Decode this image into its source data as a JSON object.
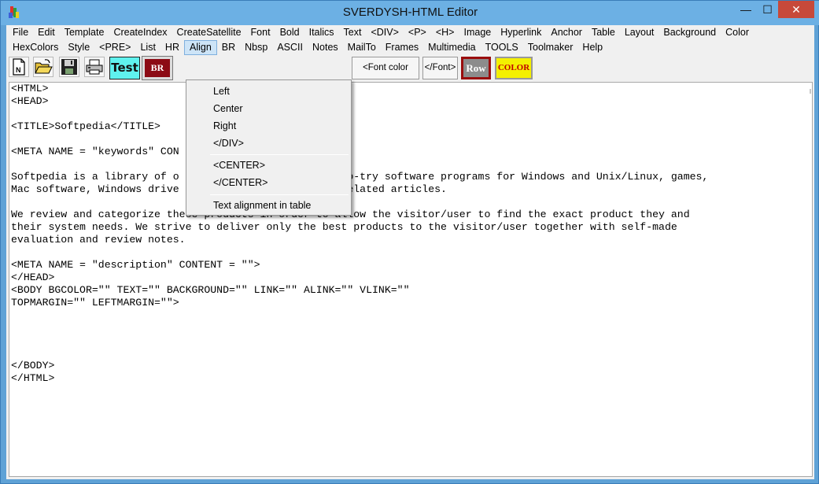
{
  "window": {
    "title": "SVERDYSH-HTML Editor",
    "min": "—",
    "max": "☐",
    "close": "✕"
  },
  "menu1": [
    "File",
    "Edit",
    "Template",
    "CreateIndex",
    "CreateSatellite",
    "Font",
    "Bold",
    "Italics",
    "Text",
    "<DIV>",
    "<P>",
    "<H>",
    "Image",
    "Hyperlink",
    "Anchor",
    "Table",
    "Layout",
    "Background",
    "Color"
  ],
  "menu2": [
    "HexColors",
    "Style",
    "<PRE>",
    "List",
    "HR",
    "Align",
    "BR",
    "Nbsp",
    "ASCII",
    "Notes",
    "MailTo",
    "Frames",
    "Multimedia",
    "TOOLS",
    "Toolmaker",
    "Help"
  ],
  "toolbar": {
    "new_icon": "new-document-icon",
    "open_icon": "open-folder-icon",
    "save_icon": "floppy-disk-icon",
    "print_icon": "printer-icon",
    "test": "Test",
    "br": "BR",
    "font_color_size": "<Font color size>",
    "font_close": "</Font>",
    "row": "Row",
    "color": "COLOR"
  },
  "align_menu": {
    "items": [
      "Left",
      "Center",
      "Right",
      "</DIV>"
    ],
    "items2": [
      "<CENTER>",
      "</CENTER>"
    ],
    "items3": [
      "Text alignment in table"
    ]
  },
  "editor_lines": [
    "<HTML>",
    "<HEAD>",
    "",
    "<TITLE>Softpedia</TITLE>",
    "",
    "<META NAME = \"keywords\" CON",
    "",
    "Softpedia is a library of o                          to-try software programs for Windows and Unix/Linux, games,",
    "Mac software, Windows drive                          related articles.",
    "",
    "We review and categorize these products in order to allow the visitor/user to find the exact product they and",
    "their system needs. We strive to deliver only the best products to the visitor/user together with self-made",
    "evaluation and review notes.",
    "",
    "<META NAME = \"description\" CONTENT = \"\">",
    "</HEAD>",
    "<BODY BGCOLOR=\"\" TEXT=\"\" BACKGROUND=\"\" LINK=\"\" ALINK=\"\" VLINK=\"\"",
    "TOPMARGIN=\"\" LEFTMARGIN=\"\">",
    "",
    "",
    "",
    "",
    "</BODY>",
    "</HTML>"
  ],
  "colors": {
    "title_bg": "#6cb0e4",
    "close_bg": "#c7493a",
    "test_bg": "#5ff2ee",
    "br_bg": "#8c0b15",
    "color_btn_bg": "#f4f000"
  }
}
